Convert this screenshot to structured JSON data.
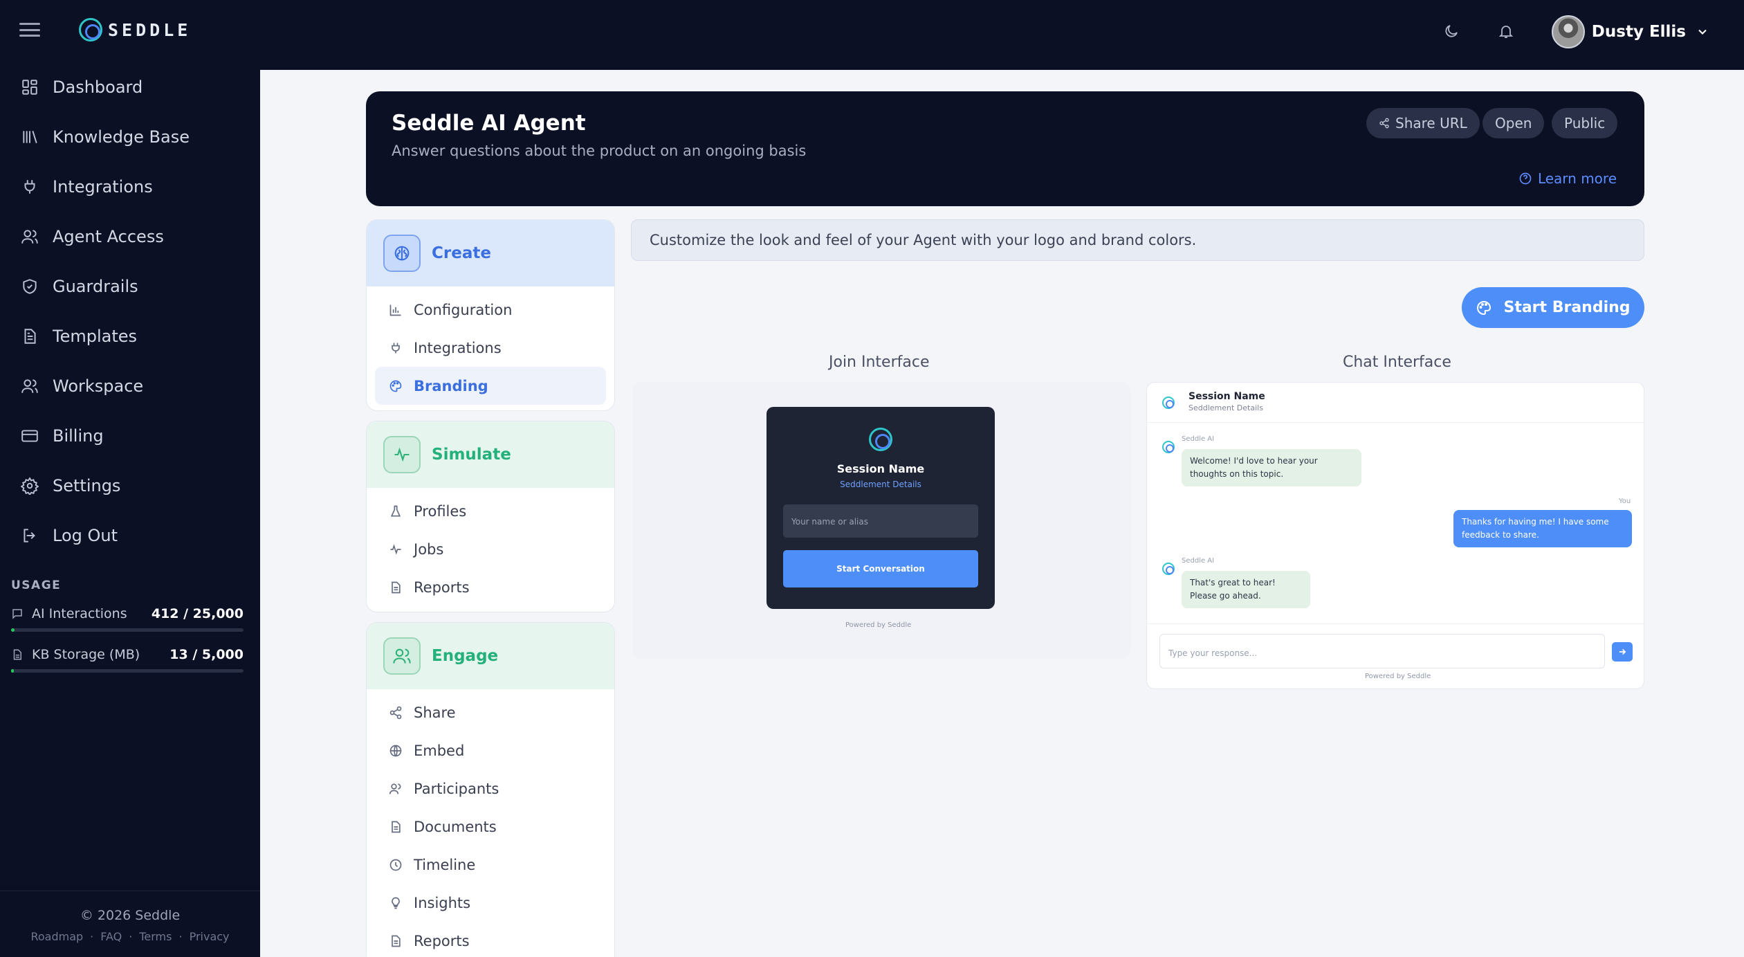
{
  "app": {
    "brand": "SEDDLE",
    "user_name": "Dusty Ellis"
  },
  "sidebar": {
    "items": [
      {
        "label": "Dashboard",
        "icon": "dashboard-icon"
      },
      {
        "label": "Knowledge Base",
        "icon": "library-icon"
      },
      {
        "label": "Integrations",
        "icon": "plug-icon"
      },
      {
        "label": "Agent Access",
        "icon": "users-icon"
      },
      {
        "label": "Guardrails",
        "icon": "shield-icon"
      },
      {
        "label": "Templates",
        "icon": "document-icon"
      },
      {
        "label": "Workspace",
        "icon": "users-icon"
      },
      {
        "label": "Billing",
        "icon": "credit-card-icon"
      },
      {
        "label": "Settings",
        "icon": "gear-icon"
      },
      {
        "label": "Log Out",
        "icon": "logout-icon"
      }
    ],
    "usage": {
      "title": "USAGE",
      "rows": [
        {
          "name": "AI Interactions",
          "value": "412 / 25,000",
          "fill_fraction": 0.016
        },
        {
          "name": "KB Storage (MB)",
          "value": "13 / 5,000",
          "fill_fraction": 0.003
        }
      ]
    },
    "footer": {
      "copyright": "© 2026 Seddle",
      "links": [
        "Roadmap",
        "FAQ",
        "Terms",
        "Privacy"
      ]
    }
  },
  "agent": {
    "title": "Seddle AI Agent",
    "subtitle": "Answer questions about the product on an ongoing basis",
    "share_label": "Share URL",
    "status_open": "Open",
    "status_public": "Public",
    "learn_more": "Learn more"
  },
  "groups": {
    "create": {
      "label": "Create",
      "items": [
        "Configuration",
        "Integrations",
        "Branding"
      ]
    },
    "simulate": {
      "label": "Simulate",
      "items": [
        "Profiles",
        "Jobs",
        "Reports"
      ]
    },
    "engage": {
      "label": "Engage",
      "items": [
        "Share",
        "Embed",
        "Participants",
        "Documents",
        "Timeline",
        "Insights",
        "Reports"
      ]
    }
  },
  "branding": {
    "info": "Customize the look and feel of your Agent with your logo and brand colors.",
    "start_button": "Start Branding",
    "join_title": "Join Interface",
    "chat_title": "Chat Interface",
    "join": {
      "session_name": "Session Name",
      "session_details": "Seddlement Details",
      "name_placeholder": "Your name or alias",
      "start_conversation": "Start Conversation",
      "powered": "Powered by Seddle"
    },
    "chat": {
      "session_name": "Session Name",
      "session_details": "Seddlement Details",
      "ai_sender": "Seddle AI",
      "user_sender": "You",
      "msg1": "Welcome! I'd love to hear your thoughts on this topic.",
      "msg2": "Thanks for having me! I have some feedback to share.",
      "msg3": "That's great to hear! Please go ahead.",
      "input_placeholder": "Type your response...",
      "powered": "Powered by Seddle"
    }
  }
}
